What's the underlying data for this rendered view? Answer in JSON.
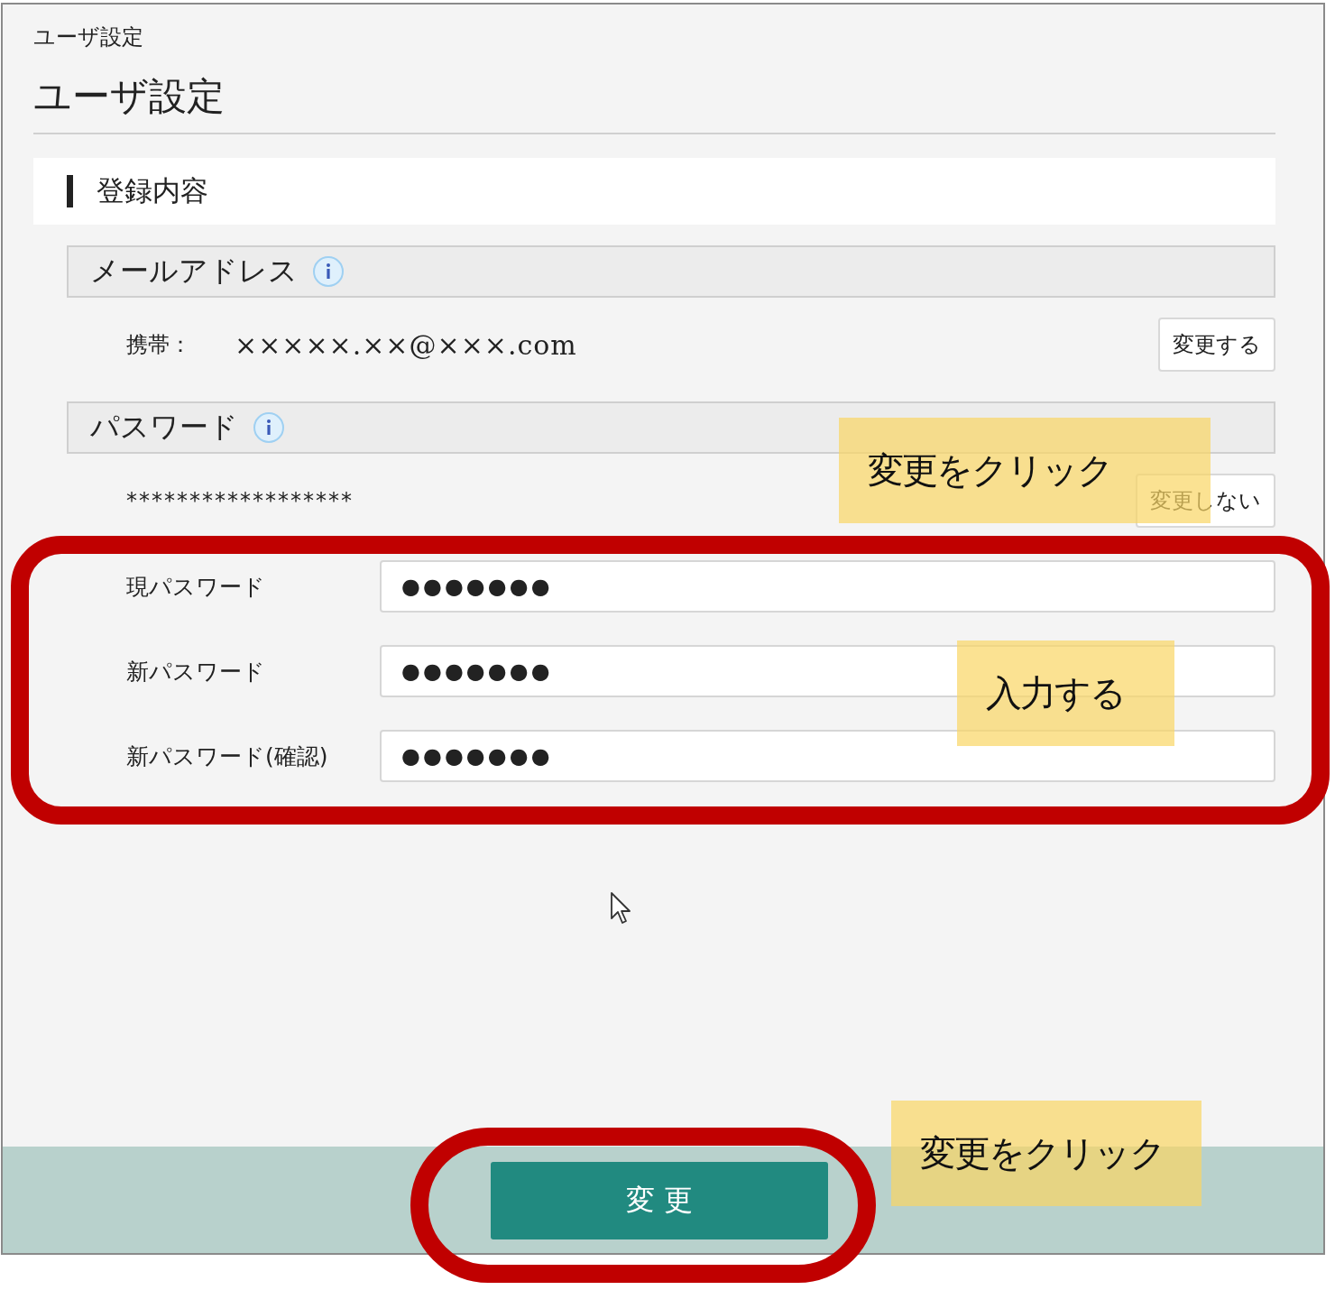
{
  "breadcrumb": "ユーザ設定",
  "title": "ユーザ設定",
  "section": {
    "title": "登録内容"
  },
  "email": {
    "header": "メールアドレス",
    "label": "携帯：",
    "value": "×××××.××@×××.com",
    "button": "変更する"
  },
  "password": {
    "header": "パスワード",
    "masked": "******************",
    "button": "変更しない",
    "fields": [
      {
        "label": "現パスワード",
        "value": "●●●●●●●"
      },
      {
        "label": "新パスワード",
        "value": "●●●●●●●"
      },
      {
        "label": "新パスワード(確認)",
        "value": "●●●●●●●"
      }
    ]
  },
  "footer": {
    "button": "変 更"
  },
  "callouts": [
    {
      "text": "変更をクリック"
    },
    {
      "text": "入力する"
    },
    {
      "text": "変更をクリック"
    }
  ]
}
